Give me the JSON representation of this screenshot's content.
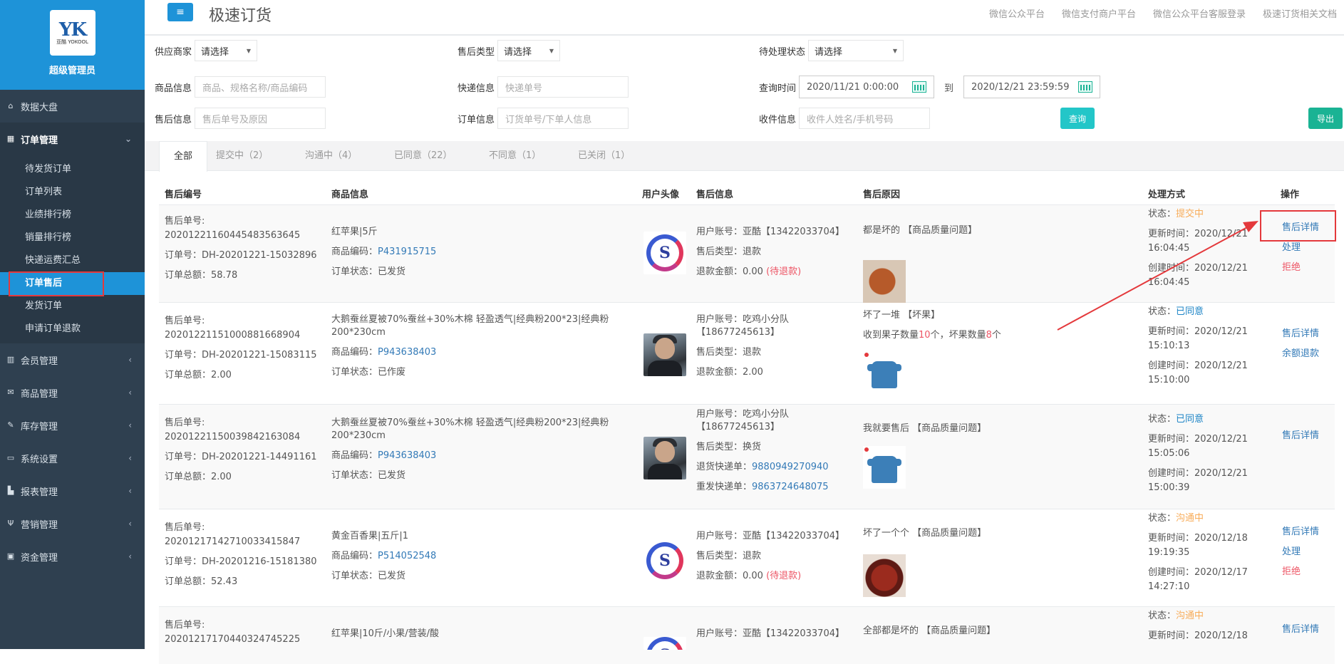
{
  "sidebar": {
    "logo_mark": "YK",
    "logo_sub": "亚酷 YOKOOL",
    "role": "超级管理员",
    "nav": [
      {
        "label": "数据大盘",
        "icon": "home-icon"
      },
      {
        "label": "订单管理",
        "icon": "order-icon",
        "open": true
      },
      {
        "label": "会员管理",
        "icon": "chart-icon"
      },
      {
        "label": "商品管理",
        "icon": "mail-icon"
      },
      {
        "label": "库存管理",
        "icon": "edit-icon"
      },
      {
        "label": "系统设置",
        "icon": "monitor-icon"
      },
      {
        "label": "报表管理",
        "icon": "bar-chart-icon"
      },
      {
        "label": "营销管理",
        "icon": "cutlery-icon"
      },
      {
        "label": "资金管理",
        "icon": "money-icon"
      }
    ],
    "order_sub": [
      "待发货订单",
      "订单列表",
      "业绩排行榜",
      "销量排行榜",
      "快递运费汇总",
      "订单售后",
      "发货订单",
      "申请订单退款"
    ]
  },
  "topbar": {
    "title": "极速订货",
    "links": [
      "微信公众平台",
      "微信支付商户平台",
      "微信公众平台客服登录",
      "极速订货相关文档"
    ]
  },
  "filters": {
    "supplier_label": "供应商家",
    "supplier_value": "请选择",
    "aftersale_type_label": "售后类型",
    "aftersale_type_value": "请选择",
    "pending_label": "待处理状态",
    "pending_value": "请选择",
    "product_label": "商品信息",
    "product_placeholder": "商品、规格名称/商品编码",
    "express_label": "快递信息",
    "express_placeholder": "快递单号",
    "time_label": "查询时间",
    "time_start": "2020/11/21 0:00:00",
    "time_to": "到",
    "time_end": "2020/12/21 23:59:59",
    "aftersale_label": "售后信息",
    "aftersale_placeholder": "售后单号及原因",
    "order_label": "订单信息",
    "order_placeholder": "订货单号/下单人信息",
    "receiver_label": "收件信息",
    "receiver_placeholder": "收件人姓名/手机号码",
    "search_button": "查询",
    "export_button": "导出"
  },
  "tabs": [
    "全部",
    "提交中（2）",
    "沟通中（4）",
    "已同意（22）",
    "不同意（1）",
    "已关闭（1）"
  ],
  "table": {
    "headers": [
      "售后编号",
      "商品信息",
      "用户头像",
      "售后信息",
      "售后原因",
      "处理方式",
      "操作"
    ],
    "rows": [
      {
        "sn_label": "售后单号:",
        "sn": "20201221160445483563645",
        "order_no": "订单号：DH-20201221-15032896",
        "total": "订单总额：58.78",
        "product_name": "红苹果|5斤",
        "code_label": "商品编码：",
        "code": "P431915715",
        "order_status": "订单状态：已发货",
        "account": "用户账号：亚酷【13422033704】",
        "type": "售后类型：退款",
        "refund_label": "退款金额：0.00 ",
        "refund_note": "(待退款)",
        "reason": "都是坏的 【商品质量问题】",
        "status_label": "状态：",
        "status": "提交中",
        "update_label": "更新时间：2020/12/21",
        "update_time": "16:04:45",
        "create_label": "创建时间：2020/12/21",
        "create_time": "16:04:45",
        "ops": [
          "售后详情",
          "处理",
          "拒绝"
        ]
      },
      {
        "sn_label": "售后单号:",
        "sn": "20201221151000881668904",
        "order_no": "订单号：DH-20201221-15083115",
        "total": "订单总额：2.00",
        "product_name": "大鹅蚕丝夏被70%蚕丝+30%木棉 轻盈透气|经典粉200*23|经典粉200*230cm",
        "code_label": "商品编码：",
        "code": "P943638403",
        "order_status": "订单状态：已作废",
        "account": "用户账号：吃鸡小分队【18677245613】",
        "type": "售后类型：退款",
        "refund_label": "退款金额：2.00",
        "reason": "坏了一堆 【坏果】",
        "reason2_a": "收到果子数量",
        "reason2_n1": "10",
        "reason2_b": "个，坏果数量",
        "reason2_n2": "8",
        "reason2_c": "个",
        "status_label": "状态：",
        "status": "已同意",
        "update_label": "更新时间：2020/12/21",
        "update_time": "15:10:13",
        "create_label": "创建时间：2020/12/21",
        "create_time": "15:10:00",
        "ops": [
          "售后详情",
          "余额退款"
        ]
      },
      {
        "sn_label": "售后单号:",
        "sn": "20201221150039842163084",
        "order_no": "订单号：DH-20201221-14491161",
        "total": "订单总额：2.00",
        "product_name": "大鹅蚕丝夏被70%蚕丝+30%木棉 轻盈透气|经典粉200*23|经典粉200*230cm",
        "code_label": "商品编码：",
        "code": "P943638403",
        "order_status": "订单状态：已发货",
        "account": "用户账号：吃鸡小分队【18677245613】",
        "type": "售后类型：换货",
        "return_label": "退货快递单：",
        "return_no": "9880949270940",
        "resend_label": "重发快递单：",
        "resend_no": "9863724648075",
        "reason": "我就要售后 【商品质量问题】",
        "status_label": "状态：",
        "status": "已同意",
        "update_label": "更新时间：2020/12/21",
        "update_time": "15:05:06",
        "create_label": "创建时间：2020/12/21",
        "create_time": "15:00:39",
        "ops": [
          "售后详情"
        ]
      },
      {
        "sn_label": "售后单号:",
        "sn": "20201217142710033415847",
        "order_no": "订单号：DH-20201216-15181380",
        "total": "订单总额：52.43",
        "product_name": "黄金百香果|五斤|1",
        "code_label": "商品编码：",
        "code": "P514052548",
        "order_status": "订单状态：已发货",
        "account": "用户账号：亚酷【13422033704】",
        "type": "售后类型：退款",
        "refund_label": "退款金额：0.00 ",
        "refund_note": "(待退款)",
        "reason": "坏了一个个 【商品质量问题】",
        "status_label": "状态：",
        "status": "沟通中",
        "update_label": "更新时间：2020/12/18",
        "update_time": "19:19:35",
        "create_label": "创建时间：2020/12/17",
        "create_time": "14:27:10",
        "ops": [
          "售后详情",
          "处理",
          "拒绝"
        ]
      },
      {
        "sn_label": "售后单号:",
        "sn": "20201217170440324745225",
        "product_name": "红苹果|10斤/小果/营装/酸",
        "account": "用户账号：亚酷【13422033704】",
        "reason": "全部都是坏的 【商品质量问题】",
        "status_label": "状态：",
        "status": "沟通中",
        "update_label": "更新时间：2020/12/18",
        "ops": [
          "售后详情"
        ]
      }
    ]
  }
}
